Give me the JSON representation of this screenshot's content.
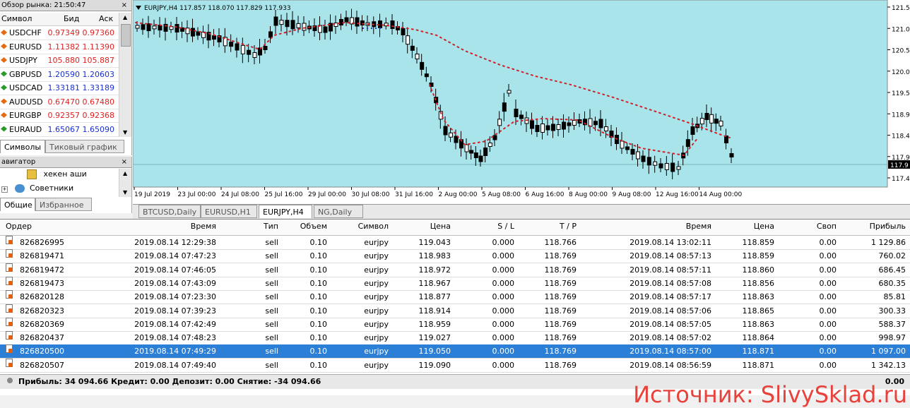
{
  "market_watch": {
    "title": "Обзор рынка: 21:50:47",
    "headers": {
      "symbol": "Символ",
      "bid": "Бид",
      "ask": "Аск"
    },
    "rows": [
      {
        "symbol": "USDCHF",
        "bid": "0.97349",
        "ask": "0.97360",
        "dir": "down"
      },
      {
        "symbol": "EURUSD",
        "bid": "1.11382",
        "ask": "1.11390",
        "dir": "down"
      },
      {
        "symbol": "USDJPY",
        "bid": "105.880",
        "ask": "105.887",
        "dir": "down"
      },
      {
        "symbol": "GBPUSD",
        "bid": "1.20590",
        "ask": "1.20603",
        "dir": "up"
      },
      {
        "symbol": "USDCAD",
        "bid": "1.33181",
        "ask": "1.33189",
        "dir": "up"
      },
      {
        "symbol": "AUDUSD",
        "bid": "0.67470",
        "ask": "0.67480",
        "dir": "down"
      },
      {
        "symbol": "EURGBP",
        "bid": "0.92357",
        "ask": "0.92368",
        "dir": "down"
      },
      {
        "symbol": "EURAUD",
        "bid": "1.65067",
        "ask": "1.65090",
        "dir": "up"
      }
    ],
    "tabs": [
      "Символы",
      "Тиковый график"
    ],
    "colors": {
      "down": "#e02020",
      "up": "#1a2fd0"
    }
  },
  "navigator": {
    "title": "авигатор",
    "items": [
      "хекен аши",
      "Советники"
    ],
    "tabs": [
      "Общие",
      "Избранное"
    ]
  },
  "chart": {
    "info": "EURJPY,H4  117.857 118.070 117.829 117.933",
    "bg": "#a8e4ea",
    "x_labels": [
      "19 Jul 2019",
      "23 Jul 00:00",
      "24 Jul 08:00",
      "25 Jul 16:00",
      "29 Jul 00:00",
      "30 Jul 08:00",
      "31 Jul 16:00",
      "2 Aug 00:00",
      "5 Aug 08:00",
      "6 Aug 16:00",
      "8 Aug 00:00",
      "9 Aug 08:00",
      "12 Aug 16:00",
      "14 Aug 00:00"
    ],
    "y_labels": [
      "121.5",
      "121.0",
      "120.5",
      "120.0",
      "119.5",
      "118.9",
      "118.4",
      "117.9",
      "117.4"
    ],
    "current_price": "117.9",
    "tabs": [
      "BTCUSD,Daily",
      "EURUSD,H1",
      "EURJPY,H4",
      "NG,Daily"
    ],
    "active_tab": 2
  },
  "terminal": {
    "headers": [
      "Ордер",
      "Время",
      "Тип",
      "Объем",
      "Символ",
      "Цена",
      "S / L",
      "T / P",
      "Время",
      "Цена",
      "Своп",
      "Прибыль"
    ],
    "orders": [
      [
        "826826995",
        "2019.08.14 12:29:38",
        "sell",
        "0.10",
        "eurjpy",
        "119.043",
        "0.000",
        "118.766",
        "2019.08.14 13:02:11",
        "118.859",
        "0.00",
        "1 129.86"
      ],
      [
        "826819471",
        "2019.08.14 07:47:23",
        "sell",
        "0.10",
        "eurjpy",
        "118.983",
        "0.000",
        "118.769",
        "2019.08.14 08:57:13",
        "118.859",
        "0.00",
        "760.02"
      ],
      [
        "826819472",
        "2019.08.14 07:46:05",
        "sell",
        "0.10",
        "eurjpy",
        "118.972",
        "0.000",
        "118.769",
        "2019.08.14 08:57:11",
        "118.860",
        "0.00",
        "686.45"
      ],
      [
        "826819473",
        "2019.08.14 07:43:09",
        "sell",
        "0.10",
        "eurjpy",
        "118.967",
        "0.000",
        "118.769",
        "2019.08.14 08:57:08",
        "118.856",
        "0.00",
        "680.35"
      ],
      [
        "826820128",
        "2019.08.14 07:23:30",
        "sell",
        "0.10",
        "eurjpy",
        "118.877",
        "0.000",
        "118.769",
        "2019.08.14 08:57:17",
        "118.863",
        "0.00",
        "85.81"
      ],
      [
        "826820323",
        "2019.08.14 07:39:23",
        "sell",
        "0.10",
        "eurjpy",
        "118.914",
        "0.000",
        "118.769",
        "2019.08.14 08:57:06",
        "118.865",
        "0.00",
        "300.33"
      ],
      [
        "826820369",
        "2019.08.14 07:42:49",
        "sell",
        "0.10",
        "eurjpy",
        "118.959",
        "0.000",
        "118.769",
        "2019.08.14 08:57:05",
        "118.863",
        "0.00",
        "588.37"
      ],
      [
        "826820437",
        "2019.08.14 07:48:23",
        "sell",
        "0.10",
        "eurjpy",
        "119.027",
        "0.000",
        "118.769",
        "2019.08.14 08:57:02",
        "118.864",
        "0.00",
        "998.97"
      ],
      [
        "826820500",
        "2019.08.14 07:49:29",
        "sell",
        "0.10",
        "eurjpy",
        "119.050",
        "0.000",
        "118.769",
        "2019.08.14 08:57:00",
        "118.871",
        "0.00",
        "1 097.00"
      ],
      [
        "826820507",
        "2019.08.14 07:49:40",
        "sell",
        "0.10",
        "eurjpy",
        "119.090",
        "0.000",
        "118.769",
        "2019.08.14 08:56:59",
        "118.871",
        "0.00",
        "1 342.13"
      ]
    ],
    "selected_row": 8,
    "status": "Прибыль: 34 094.66  Кредит: 0.00  Депозит: 0.00  Снятие: -34 094.66",
    "status_total": "0.00"
  },
  "watermark": "Источник: SlivySklad.ru"
}
